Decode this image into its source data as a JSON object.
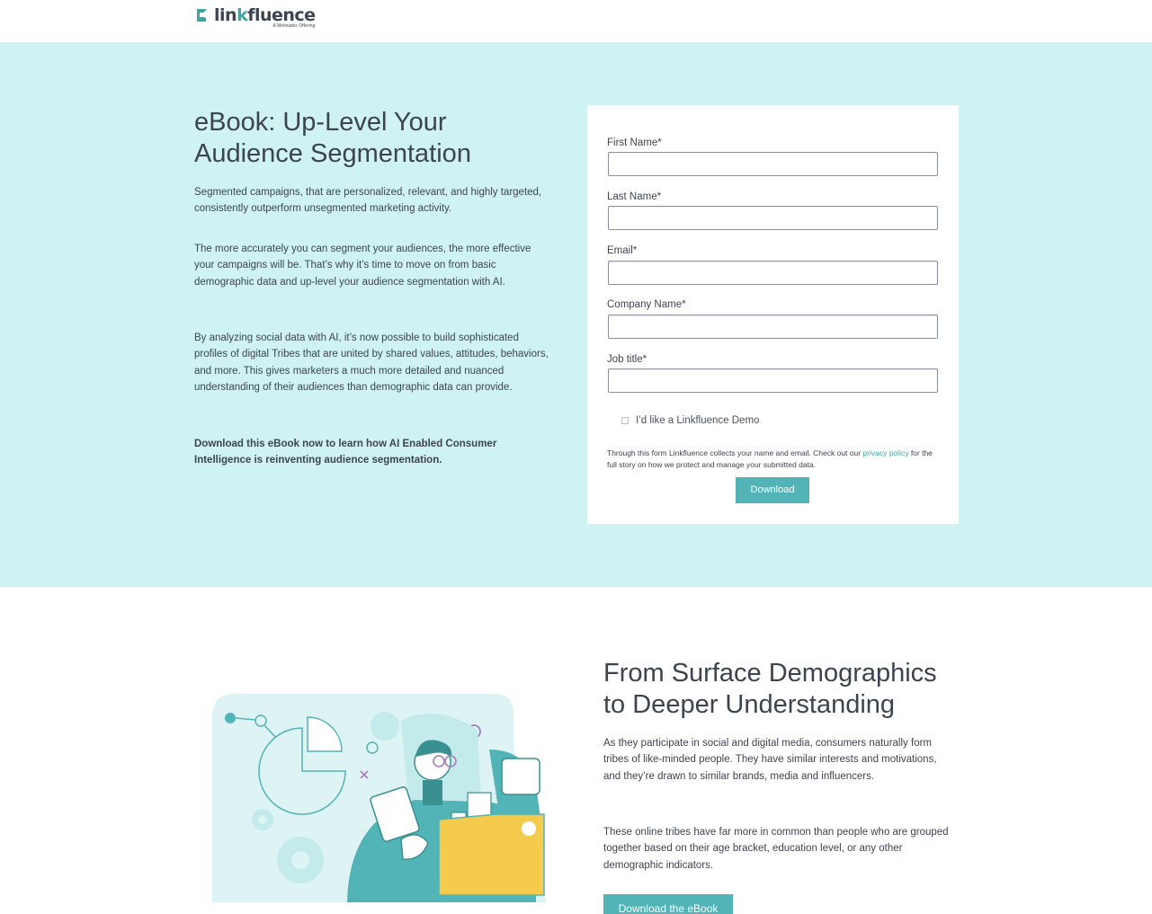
{
  "header": {
    "logo_word_a": "lin",
    "logo_word_k": "k",
    "logo_word_b": "fluence",
    "logo_tagline": "A Meltwater Offering"
  },
  "hero": {
    "title": "eBook: Up-Level Your Audience Segmentation",
    "paragraph_1": "Segmented campaigns, that are personalized, relevant, and highly targeted, consistently outperform unsegmented marketing activity.",
    "paragraph_2": "The more accurately you can segment your audiences, the more effective your campaigns will be. That’s why it’s time to move on from basic demographic data and up-level your audience segmentation with AI.",
    "paragraph_3": "By analyzing social data with AI, it’s now possible to build sophisticated profiles of digital Tribes that are united by shared values, attitudes, behaviors, and more. This gives marketers a much more detailed and nuanced understanding of their audiences than demographic data can provide.",
    "paragraph_4": "Download this eBook now to learn how AI Enabled Consumer Intelligence is reinventing audience segmentation."
  },
  "form": {
    "fields": [
      {
        "label": "First Name*",
        "value": ""
      },
      {
        "label": "Last Name*",
        "value": ""
      },
      {
        "label": "Email*",
        "value": ""
      },
      {
        "label": "Company Name*",
        "value": ""
      },
      {
        "label": "Job title*",
        "value": ""
      }
    ],
    "checkbox_label": "I’d like a Linkfluence Demo",
    "privacy_text_before": "Through this form Linkfluence collects your name and email. Check out our ",
    "privacy_link": "privacy policy",
    "privacy_text_after": " for the full story on how we protect and manage your submitted data.",
    "submit_label": "Download"
  },
  "section2": {
    "title": "From Surface Demographics to Deeper Understanding",
    "paragraph_1": "As they participate in social and digital media, consumers naturally form tribes of like-minded people. They have similar interests and motivations, and they’re drawn to similar brands, media and influencers.",
    "paragraph_2": "These online tribes have far more in common than people who are grouped together based on their age bracket, education level, or any other demographic indicators.",
    "cta_label": "Download the eBook"
  },
  "colors": {
    "hero_bg": "#cff2f3",
    "accent": "#52b4b6",
    "text": "#3d4451",
    "folder_yellow": "#f5cb4e"
  }
}
